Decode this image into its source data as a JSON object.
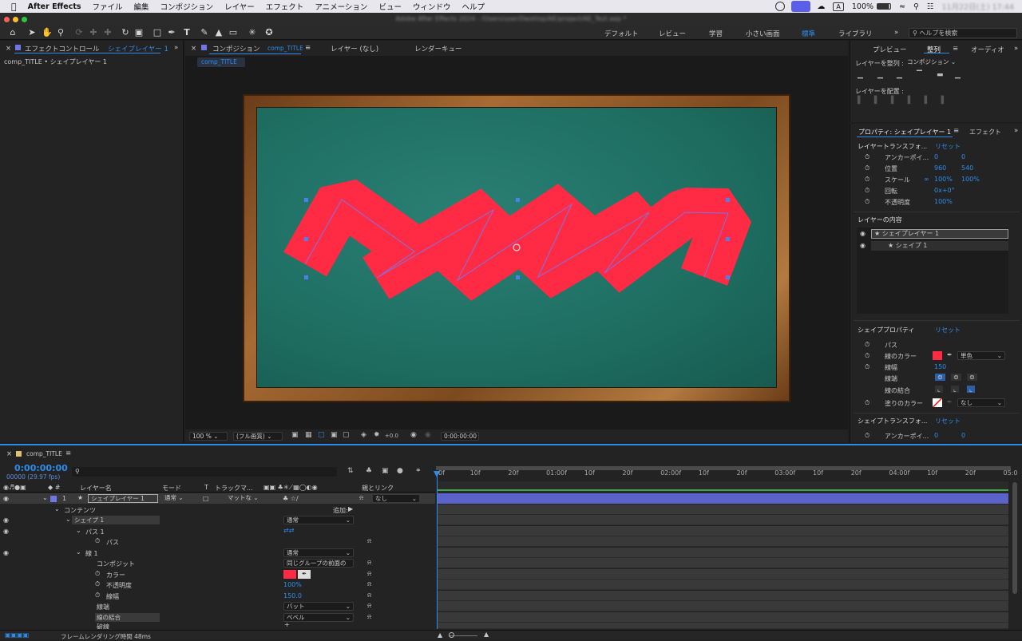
{
  "menubar": {
    "app": "After Effects",
    "items": [
      "ファイル",
      "編集",
      "コンポジション",
      "レイヤー",
      "エフェクト",
      "アニメーション",
      "ビュー",
      "ウィンドウ",
      "ヘルプ"
    ],
    "battery": "100%",
    "time": "11月22日(土) 17:44"
  },
  "titlebar": {
    "text": "Adobe After Effects 2024 - /Users/user/Desktop/AE/project/AE_Test.aep *"
  },
  "toolbar": {
    "workspaces": [
      "デフォルト",
      "レビュー",
      "学習",
      "小さい画面",
      "標準",
      "ライブラリ"
    ],
    "help_placeholder": "ヘルプを検索"
  },
  "effect_panel": {
    "tab": "エフェクトコントロール",
    "tab_layer": "シェイプレイヤー 1",
    "breadcrumb": "comp_TITLE • シェイプレイヤー 1"
  },
  "comp_panel": {
    "tab_comp": "コンポジション",
    "tab_comp_name": "comp_TITLE",
    "tab_layer": "レイヤー (なし)",
    "tab_render": "レンダーキュー",
    "subtab": "comp_TITLE"
  },
  "viewer_bar": {
    "zoom": "100 %",
    "quality": "(フル画質)",
    "exposure": "+0.0",
    "timecode": "0:00:00:00"
  },
  "right_top": {
    "tabs": [
      "プレビュー",
      "整列",
      "オーディオ"
    ],
    "align_to_label": "レイヤーを整列 :",
    "align_to_value": "コンポジション",
    "distribute_label": "レイヤーを配置 :"
  },
  "properties": {
    "tab": "プロパティ: シェイプレイヤー 1",
    "tab2": "エフェクト",
    "transform_head": "レイヤートランスフォ...",
    "reset": "リセット",
    "rows": [
      {
        "label": "アンカーポイ...",
        "v1": "0",
        "v2": "0"
      },
      {
        "label": "位置",
        "v1": "960",
        "v2": "540"
      },
      {
        "label": "スケール",
        "v1": "100%",
        "v2": "100%"
      },
      {
        "label": "回転",
        "v1": "0x+0°",
        "v2": ""
      },
      {
        "label": "不透明度",
        "v1": "100%",
        "v2": ""
      }
    ],
    "contents_head": "レイヤーの内容",
    "layer_item": "シェイプレイヤー 1",
    "shape_item": "シェイプ 1",
    "shape_props_head": "シェイププロパティ",
    "path_label": "パス",
    "stroke_color_label": "線のカラー",
    "stroke_type": "単色",
    "stroke_width_label": "線幅",
    "stroke_width": "150",
    "cap_label": "線端",
    "join_label": "線の結合",
    "fill_label": "塗りのカラー",
    "fill_value": "なし",
    "shape_transform_head": "シェイプトランスフォ...",
    "shape_anchor_label": "アンカーポイ...",
    "shape_anchor_v1": "0",
    "shape_anchor_v2": "0"
  },
  "timeline": {
    "tab": "comp_TITLE",
    "timecode": "0:00:00:00",
    "fps": "00000 (29.97 fps)",
    "col_layer_name": "レイヤー名",
    "col_mode": "モード",
    "col_t": "T",
    "col_track": "トラックマ...",
    "col_parent": "親とリンク",
    "layer_num": "1",
    "layer_name": "シェイプレイヤー 1",
    "layer_mode": "通常",
    "layer_matte": "マットな",
    "layer_parent": "なし",
    "contents": "コンテンツ",
    "add": "追加:",
    "shape1": "シェイプ 1",
    "shape1_mode": "通常",
    "path1": "パス 1",
    "path": "パス",
    "stroke1": "線 1",
    "stroke1_mode": "通常",
    "composite": "コンポジット",
    "composite_val": "同じグループの前面の",
    "color": "カラー",
    "opacity": "不透明度",
    "opacity_val": "100%",
    "stroke_width": "線幅",
    "stroke_width_val": "150.0",
    "cap": "線端",
    "cap_val": "バット",
    "join": "線の結合",
    "join_val": "ベベル",
    "dash": "破線",
    "render_time": "フレームレンダリング時間 48ms",
    "ruler": [
      "0f",
      "10f",
      "20f",
      "01:00f",
      "10f",
      "20f",
      "02:00f",
      "10f",
      "20f",
      "03:00f",
      "10f",
      "20f",
      "04:00f",
      "10f",
      "20f",
      "05:0"
    ]
  },
  "colors": {
    "accent": "#2d8ceb",
    "stroke": "#ff2a43",
    "board": "#1f6f63",
    "frame": "#8b5426",
    "layer_bar": "#5b63c9"
  },
  "icons": [
    "apple-icon",
    "home-icon",
    "selection-tool-icon",
    "hand-tool-icon",
    "zoom-tool-icon",
    "pen-tool-icon",
    "text-tool-icon",
    "brush-tool-icon",
    "eraser-tool-icon",
    "puppet-tool-icon",
    "search-icon",
    "eye-icon",
    "stopwatch-icon",
    "wifi-icon",
    "eyedropper-icon"
  ]
}
